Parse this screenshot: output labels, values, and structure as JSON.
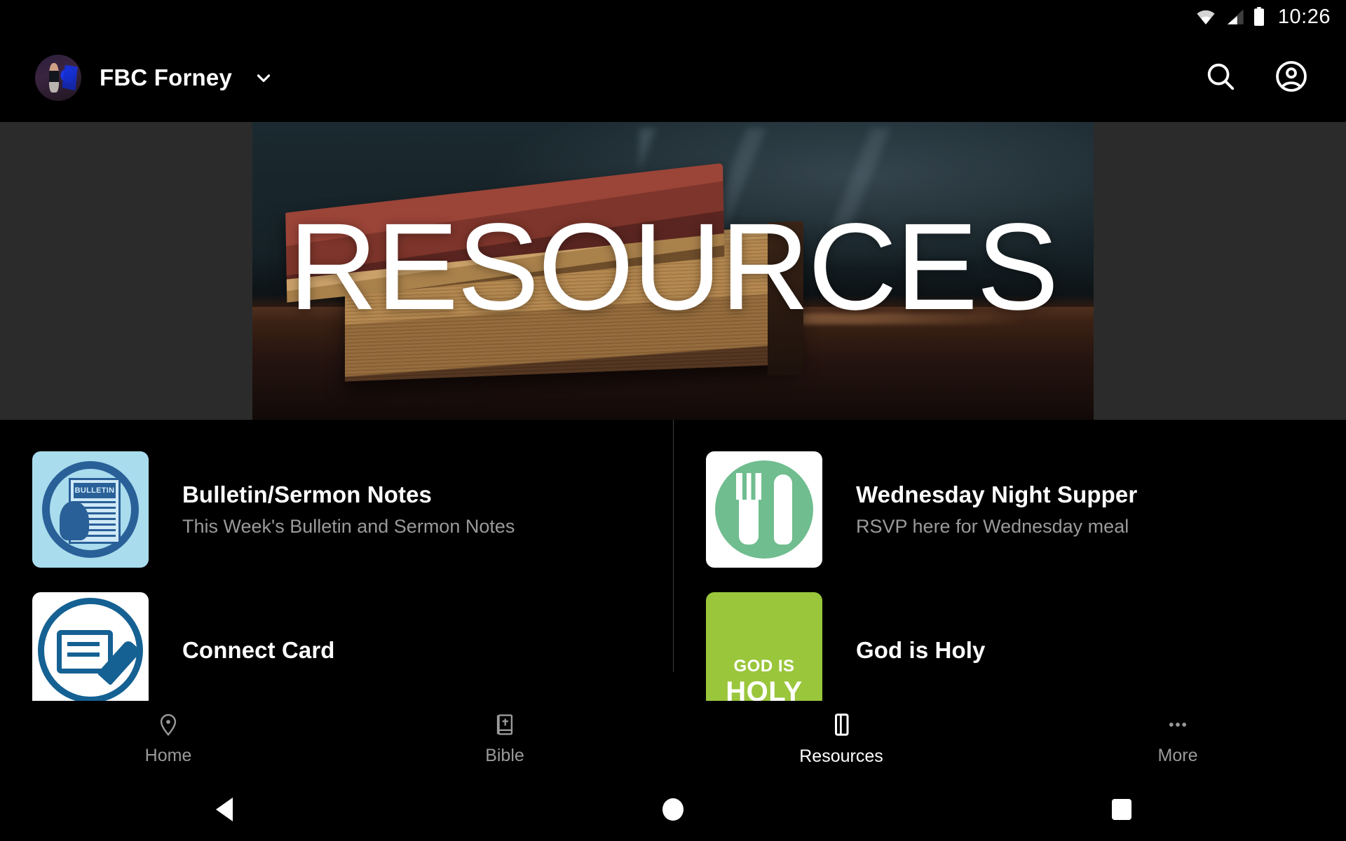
{
  "status_bar": {
    "time": "10:26",
    "icons": [
      "wifi-icon",
      "cell-signal-icon",
      "battery-icon"
    ]
  },
  "app_bar": {
    "church_name": "FBC Forney",
    "avatar": "church-avatar",
    "dropdown_icon": "chevron-down-icon",
    "search_icon": "search-icon",
    "account_icon": "account-circle-icon"
  },
  "hero": {
    "title": "RESOURCES",
    "image_description": "stacked-old-books-on-wooden-desk"
  },
  "resources": [
    {
      "title": "Bulletin/Sermon Notes",
      "subtitle": "This Week's Bulletin and Sermon Notes",
      "icon": "bulletin-newspaper-icon",
      "tile_bg": "#a9dced",
      "tile_accent": "#2a6098",
      "masthead": "BULLETIN"
    },
    {
      "title": "Wednesday Night Supper",
      "subtitle": "RSVP here for Wednesday meal",
      "icon": "fork-and-knife-icon",
      "tile_bg": "#ffffff",
      "tile_accent": "#70bd8f"
    },
    {
      "title": "Connect Card",
      "subtitle": "",
      "icon": "card-and-pen-icon",
      "tile_bg": "#ffffff",
      "tile_accent": "#156193"
    },
    {
      "title": "God is Holy",
      "subtitle": "",
      "icon": "god-is-holy-graphic",
      "tile_bg": "#9ac63c",
      "tile_text_line1": "GOD IS",
      "tile_text_line2": "HOLY"
    }
  ],
  "tab_bar": {
    "active": "Resources",
    "tabs": [
      {
        "label": "Home",
        "icon": "location-pin-icon"
      },
      {
        "label": "Bible",
        "icon": "bible-book-icon"
      },
      {
        "label": "Resources",
        "icon": "resources-book-icon"
      },
      {
        "label": "More",
        "icon": "more-dots-icon"
      }
    ]
  },
  "android_nav": {
    "back": "back-triangle-icon",
    "home": "home-circle-icon",
    "recents": "recents-square-icon"
  },
  "colors": {
    "background": "#000000",
    "hero_letterbox": "#2b2b2b",
    "divider": "#3a3a3a",
    "secondary_text": "#9a9a9a",
    "primary_text": "#ffffff"
  }
}
